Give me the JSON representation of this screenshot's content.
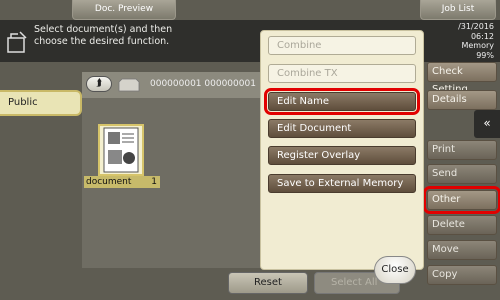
{
  "tabs": {
    "preview": "Doc. Preview",
    "job_list": "Job List"
  },
  "instruction": "Select document(s) and then\nchoose the desired function.",
  "status": {
    "date": "/31/2016",
    "time": "06:12",
    "memory_label": "Memory",
    "memory_value": "99%"
  },
  "box": {
    "tab": "Public",
    "path": "000000001  000000001"
  },
  "document": {
    "name": "document",
    "number": "1"
  },
  "popup": {
    "items": [
      {
        "label": "Combine",
        "state": "disabled"
      },
      {
        "label": "Combine TX",
        "state": "disabled"
      },
      {
        "label": "Edit Name",
        "state": "enabled",
        "highlight": true
      },
      {
        "label": "Edit Document",
        "state": "enabled"
      },
      {
        "label": "Register Overlay",
        "state": "enabled"
      },
      {
        "label": "Save to External Memory",
        "state": "enabled"
      }
    ],
    "close": "Close"
  },
  "side_buttons": [
    {
      "label": "Check Setting"
    },
    {
      "label": "Details"
    },
    {
      "label": "Print"
    },
    {
      "label": "Send"
    },
    {
      "label": "Other",
      "highlight": true
    },
    {
      "label": "Delete"
    },
    {
      "label": "Move"
    },
    {
      "label": "Copy"
    }
  ],
  "collapse_icon": "«",
  "bottom": {
    "reset": "Reset",
    "select_all": "Select All"
  },
  "colors": {
    "highlight": "#e10000",
    "popup_bg": "#f1ecd2",
    "menu_button": "#6e5c49"
  }
}
